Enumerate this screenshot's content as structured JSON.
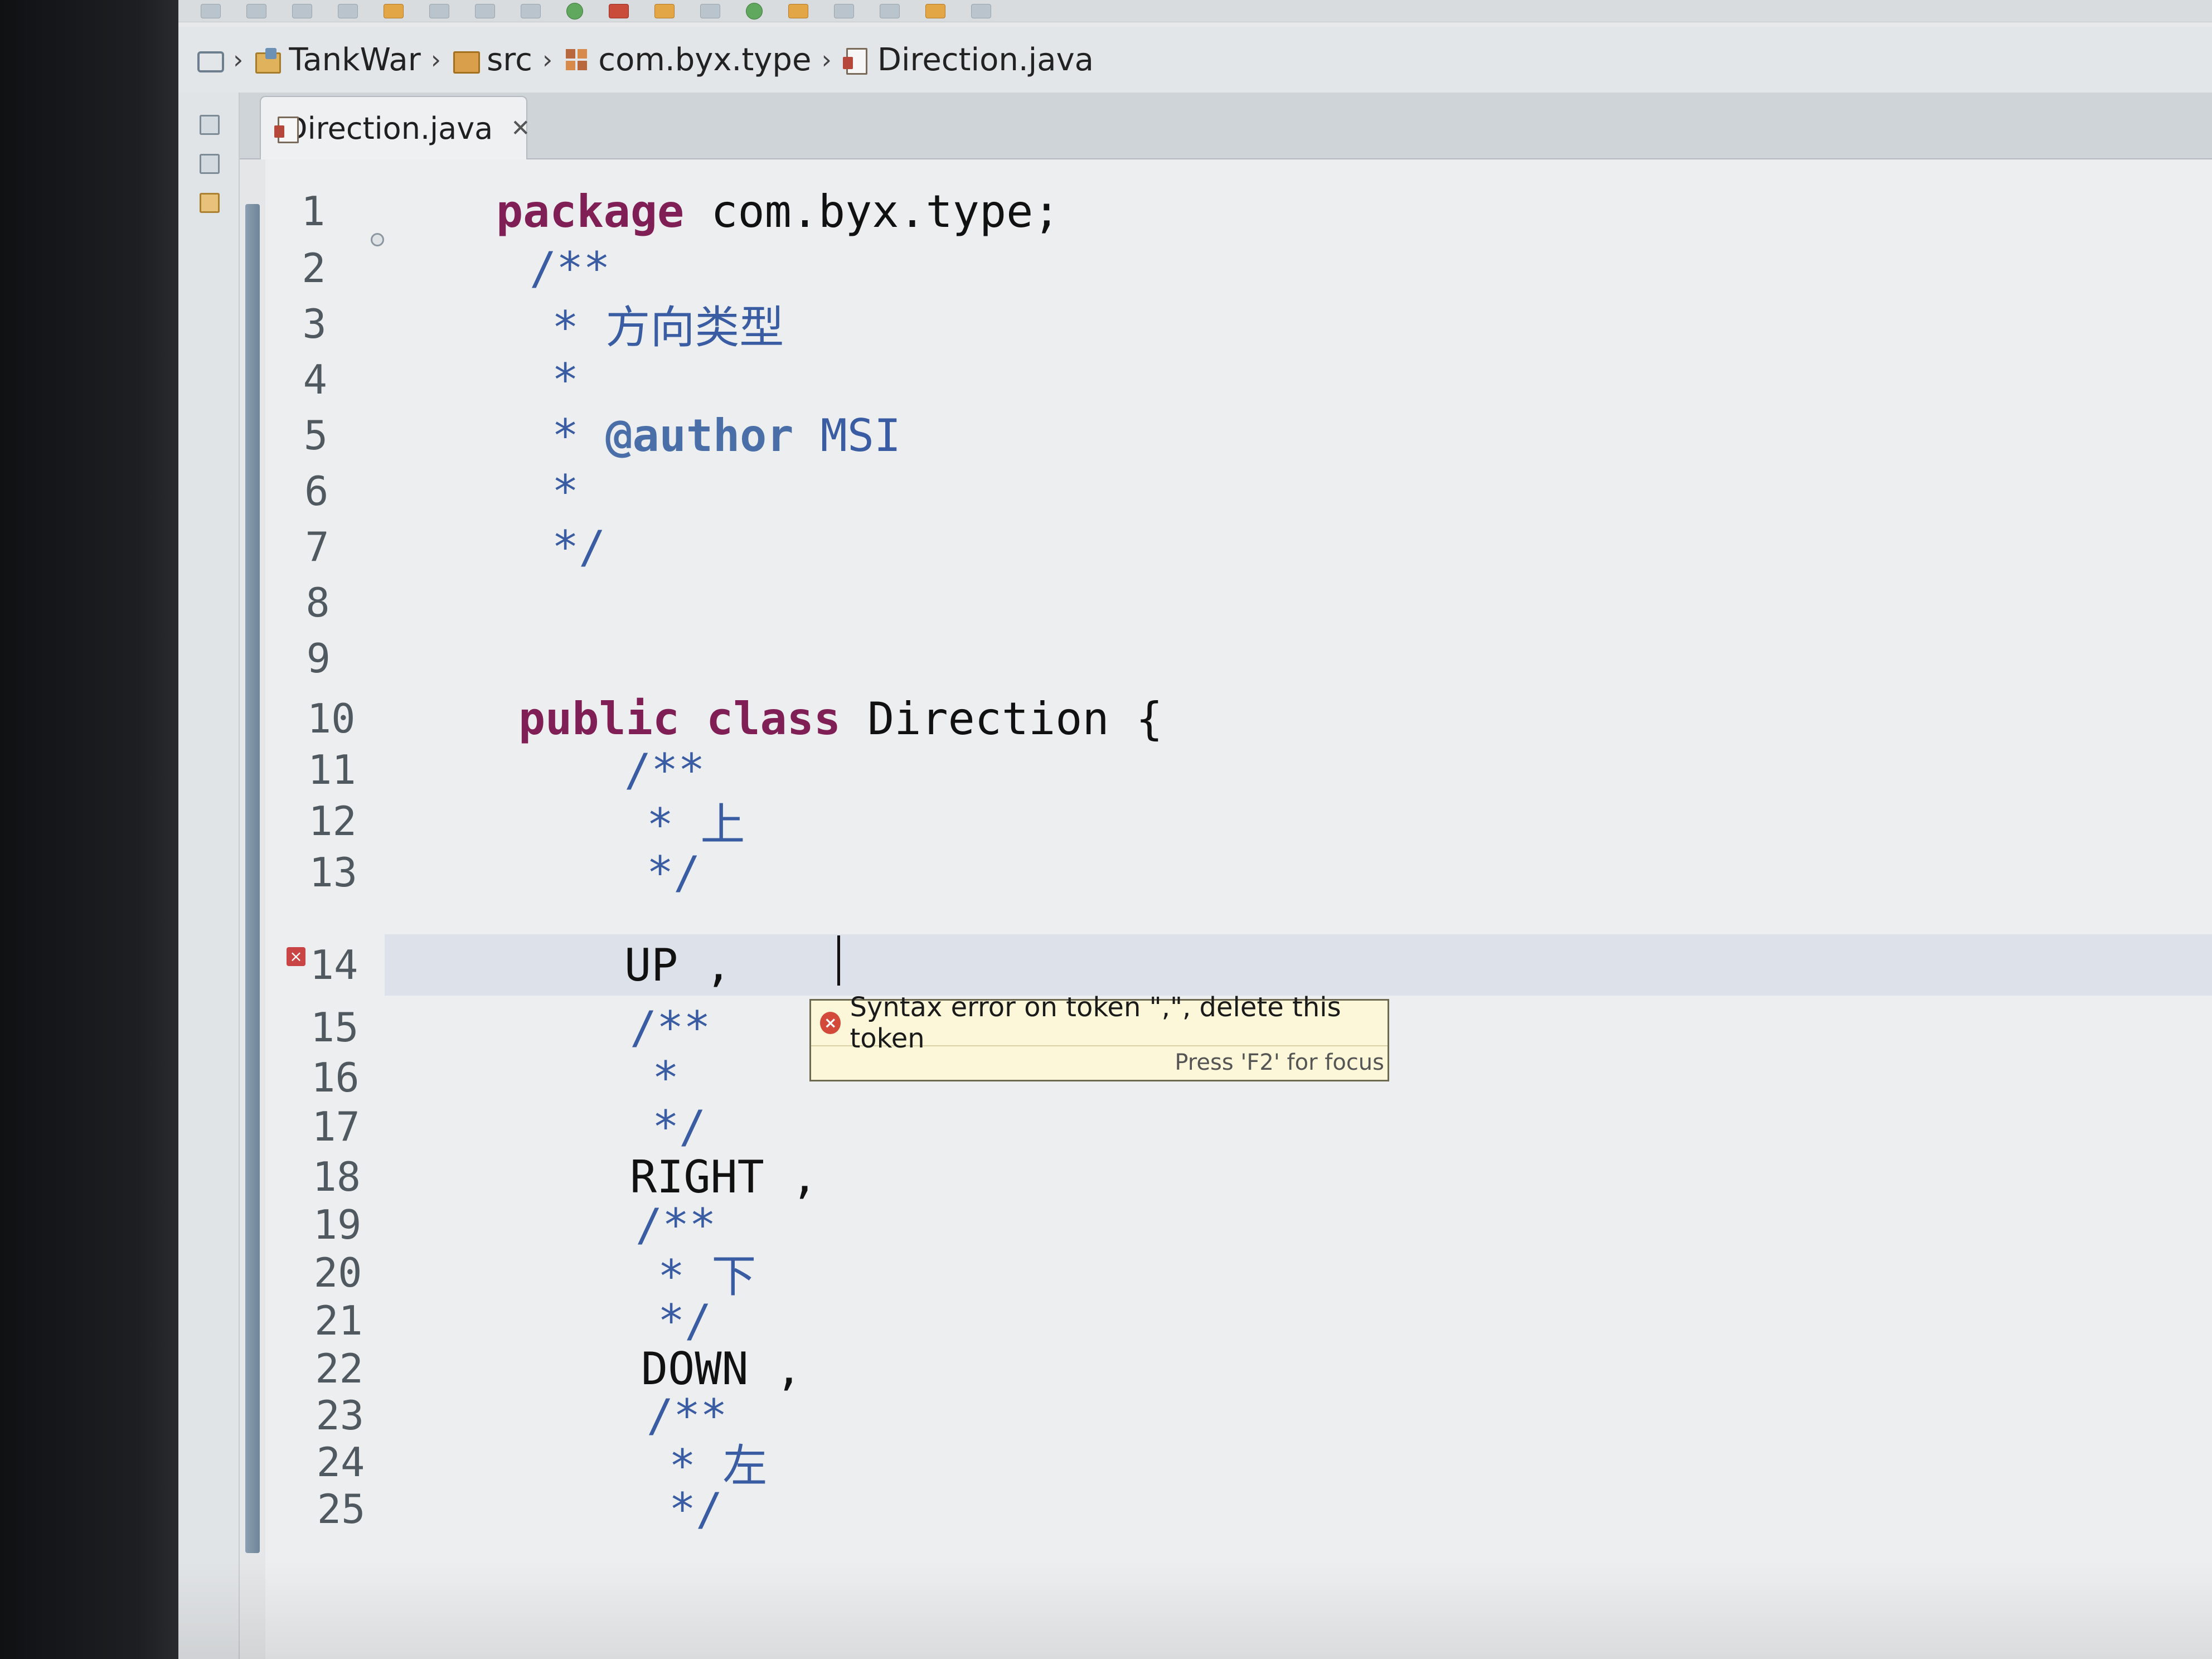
{
  "breadcrumb": {
    "project": "TankWar",
    "folder": "src",
    "package": "com.byx.type",
    "file": "Direction.java",
    "separator": "›"
  },
  "tab": {
    "label": "Direction.java",
    "close_glyph": "✕"
  },
  "editor": {
    "lines": [
      {
        "n": "1",
        "parts": [
          "package",
          " com.byx.type;"
        ]
      },
      {
        "n": "2",
        "parts": [
          "/**"
        ]
      },
      {
        "n": "3",
        "parts": [
          "* ",
          "方向类型"
        ]
      },
      {
        "n": "4",
        "parts": [
          "*"
        ]
      },
      {
        "n": "5",
        "parts": [
          "* ",
          "@author",
          " MSI"
        ]
      },
      {
        "n": "6",
        "parts": [
          "*"
        ]
      },
      {
        "n": "7",
        "parts": [
          "*/"
        ]
      },
      {
        "n": "8",
        "parts": [
          ""
        ]
      },
      {
        "n": "9",
        "parts": [
          ""
        ]
      },
      {
        "n": "10",
        "parts": [
          "public",
          " ",
          "class",
          " Direction {"
        ]
      },
      {
        "n": "11",
        "parts": [
          "/**"
        ]
      },
      {
        "n": "12",
        "parts": [
          "* ",
          "上"
        ]
      },
      {
        "n": "13",
        "parts": [
          "*/"
        ]
      },
      {
        "n": "14",
        "parts": [
          "UP ,"
        ]
      },
      {
        "n": "15",
        "parts": [
          "/**"
        ]
      },
      {
        "n": "16",
        "parts": [
          "*"
        ]
      },
      {
        "n": "17",
        "parts": [
          "*/"
        ]
      },
      {
        "n": "18",
        "parts": [
          "RIGHT ,"
        ]
      },
      {
        "n": "19",
        "parts": [
          "/**"
        ]
      },
      {
        "n": "20",
        "parts": [
          "* ",
          "下"
        ]
      },
      {
        "n": "21",
        "parts": [
          "*/"
        ]
      },
      {
        "n": "22",
        "parts": [
          "DOWN ,"
        ]
      },
      {
        "n": "23",
        "parts": [
          "/**"
        ]
      },
      {
        "n": "24",
        "parts": [
          "* ",
          "左"
        ]
      },
      {
        "n": "25",
        "parts": [
          "*/"
        ]
      }
    ]
  },
  "tooltip": {
    "message": "Syntax error on token \",\", delete this token",
    "hint": "Press 'F2' for focus",
    "icon_glyph": "×"
  },
  "error_marker_glyph": "×",
  "icons": {
    "navigate": "navigate-icon",
    "project": "project-icon",
    "source_folder": "source-folder-icon",
    "package": "package-icon",
    "java_file": "java-file-icon",
    "error": "error-icon"
  },
  "colors": {
    "keyword": "#7f1f55",
    "comment": "#3a5ca3",
    "tooltip_bg": "#fbf7d8",
    "error": "#d44a3a"
  }
}
